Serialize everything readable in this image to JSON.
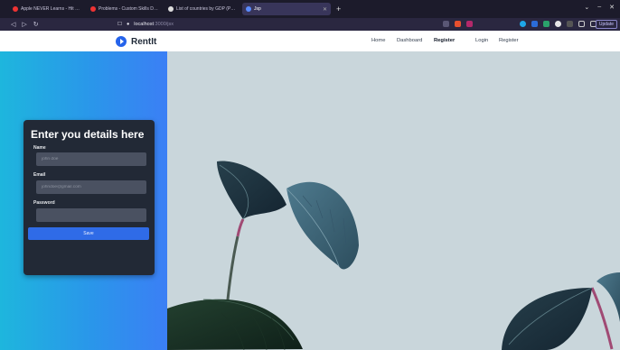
{
  "browser": {
    "tabs": [
      {
        "title": "Apple NEVER Learns - Hit Mu…",
        "color": "#e33"
      },
      {
        "title": "Problems - Custom Skills Develo…",
        "color": "#e33"
      },
      {
        "title": "List of countries by GDP (PPP)…",
        "color": "#ddd"
      },
      {
        "title": "Jsp",
        "color": "#5b8cff",
        "active": true
      }
    ],
    "new_tab_label": "+",
    "url_host": "localhost",
    "url_port": ":3000/jsx",
    "update_label": "Update"
  },
  "nav": {
    "brand": "RentIt",
    "links": [
      "Home",
      "Dashboard",
      "Register",
      "Login",
      "Register"
    ]
  },
  "form": {
    "title": "Enter you details here",
    "name_label": "Name",
    "name_placeholder": "john doe",
    "email_label": "Email",
    "email_placeholder": "johndoe@gmail.com",
    "password_label": "Password",
    "save_label": "Save"
  },
  "colors": {
    "accent": "#2f6be7",
    "gradient_start": "#1eb6dd",
    "gradient_end": "#3b7ff5",
    "card_bg": "#222936"
  }
}
